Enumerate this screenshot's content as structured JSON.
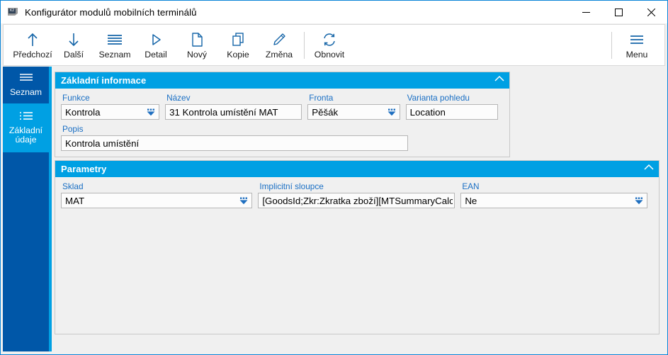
{
  "window": {
    "title": "Konfigurátor modulů mobilních terminálů",
    "app_icon": "k2-app-icon",
    "icon_text": "K2",
    "minimize_label": "Minimalizovat",
    "maximize_label": "Maximalizovat",
    "close_label": "Zavřít",
    "accent_color": "#00a0e3",
    "dark_blue": "#0057a8"
  },
  "toolbar": {
    "items": [
      {
        "label": "Předchozí",
        "icon": "arrow-up-icon"
      },
      {
        "label": "Další",
        "icon": "arrow-down-icon"
      },
      {
        "label": "Seznam",
        "icon": "list-lines-icon"
      },
      {
        "label": "Detail",
        "icon": "play-triangle-icon"
      },
      {
        "label": "Nový",
        "icon": "new-document-icon"
      },
      {
        "label": "Kopie",
        "icon": "copy-icon"
      },
      {
        "label": "Změna",
        "icon": "pencil-icon"
      },
      {
        "label": "Obnovit",
        "icon": "refresh-icon"
      }
    ],
    "menu": {
      "label": "Menu",
      "icon": "hamburger-menu-icon"
    }
  },
  "sidebar": {
    "items": [
      {
        "label": "Seznam",
        "icon": "list-lines-icon",
        "active": false
      },
      {
        "label": "Základní\núdaje",
        "label_line1": "Základní",
        "label_line2": "údaje",
        "icon": "bullet-list-icon",
        "active": true
      }
    ]
  },
  "groups": {
    "basic": {
      "title": "Základní informace",
      "collapse_icon": "chevron-up-icon",
      "fields": {
        "funkce": {
          "label": "Funkce",
          "value": "Kontrola",
          "type": "dropdown"
        },
        "nazev": {
          "label": "Název",
          "value": "31 Kontrola umístění MAT",
          "type": "text"
        },
        "fronta": {
          "label": "Fronta",
          "value": "Pěšák",
          "type": "dropdown"
        },
        "varianta": {
          "label": "Varianta pohledu",
          "value": "Location",
          "type": "text"
        },
        "popis": {
          "label": "Popis",
          "value": "Kontrola umístění",
          "type": "text"
        }
      }
    },
    "params": {
      "title": "Parametry",
      "collapse_icon": "chevron-up-icon",
      "fields": {
        "sklad": {
          "label": "Sklad",
          "value": "MAT",
          "type": "dropdown"
        },
        "implicitni_sloupce": {
          "label": "Implicitní sloupce",
          "value": "[GoodsId;Zkr:Zkratka zboží][MTSummaryCalc:S",
          "type": "text"
        },
        "ean": {
          "label": "EAN",
          "value": "Ne",
          "type": "dropdown"
        }
      }
    }
  }
}
